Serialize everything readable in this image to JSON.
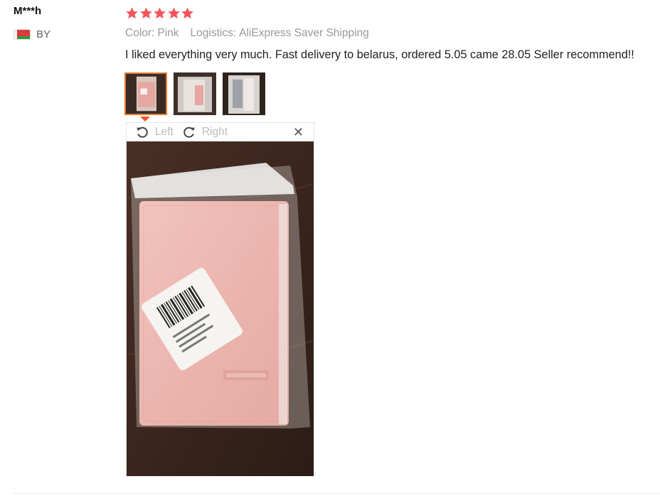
{
  "review": {
    "user": "M***h",
    "country_code": "BY",
    "rating": 5,
    "color_label": "Color:",
    "color_value": "Pink",
    "logistics_label": "Logistics:",
    "logistics_value": "AliExpress Saver Shipping",
    "text": "I liked everything very much. Fast delivery to belarus, ordered 5.05 came 28.05 Seller recommend!!"
  },
  "viewer": {
    "rotate_left_label": "Left",
    "rotate_right_label": "Right",
    "close_symbol": "✕"
  },
  "icons": {
    "star": "star-icon",
    "rotate_left": "rotate-left-icon",
    "rotate_right": "rotate-right-icon",
    "close": "close-icon",
    "flag": "flag-icon"
  },
  "colors": {
    "star": "#f2545b",
    "active_thumb_border": "#e47a2c",
    "caret": "#f0572a",
    "muted_text": "#999999"
  }
}
